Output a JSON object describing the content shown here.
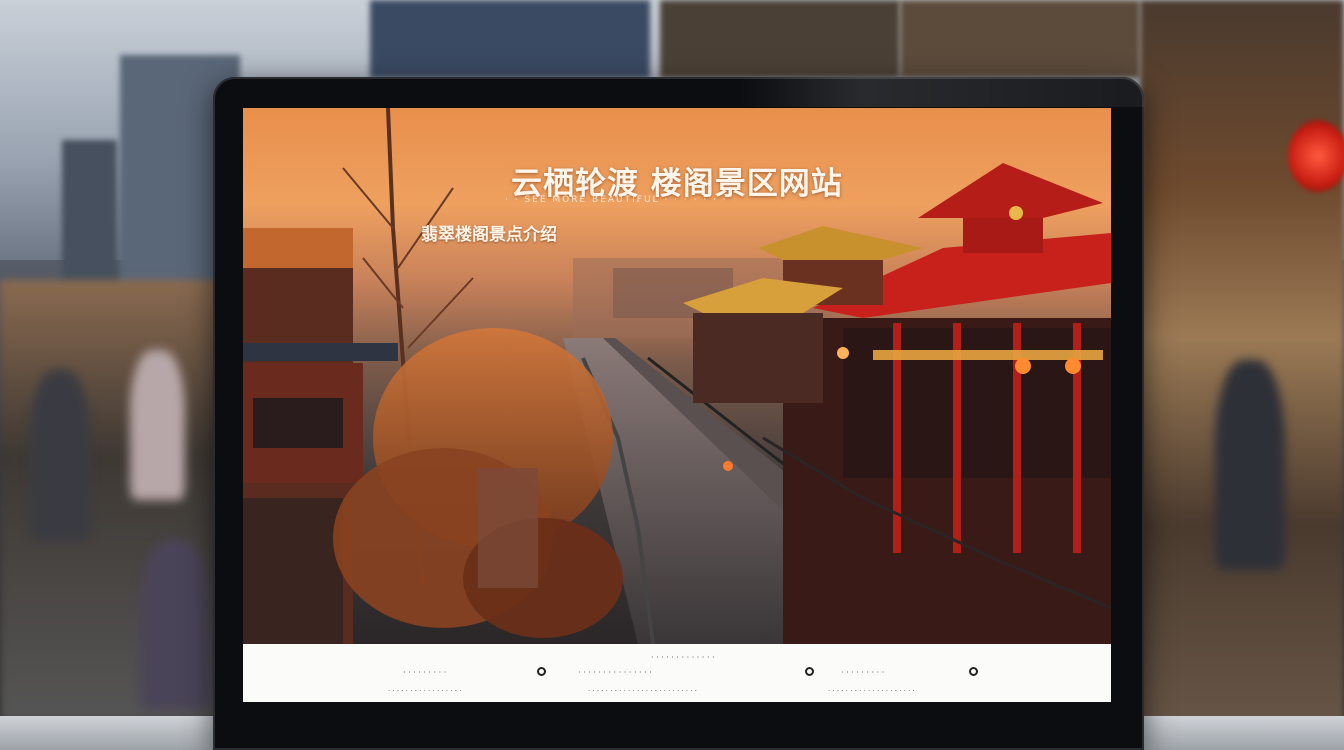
{
  "page": {
    "title": "云栖轮渡 楼阁景区网站",
    "tagline": "· · SEE MORE BEAUTIFUL · · · · · · ·",
    "subtitle": "翡翠楼阁景点介绍"
  },
  "footer": {
    "center_title": "· · · · · · · · · · · · ·",
    "left_group": "· · · · · · · · ·",
    "middle_group": "· · · · · · · · · · · · · · ·",
    "right_group": "· · · · · · · · ·",
    "left_line": "· · · · · · · · · · · · · · · · ·",
    "middle_line": "· · · · · · · · · · · · · · · · · · · · · · · · ·",
    "right_line": "· · · · · · · · · · · · · · · · · · · ·"
  },
  "icons": {
    "left_footer_icon": "location-icon",
    "middle_footer_icon": "phone-icon",
    "right_footer_icon": "mail-icon"
  },
  "colors": {
    "hero_orange": "#eea05f",
    "roof_red": "#c8201b",
    "footer_bg": "#fbfbfa"
  }
}
